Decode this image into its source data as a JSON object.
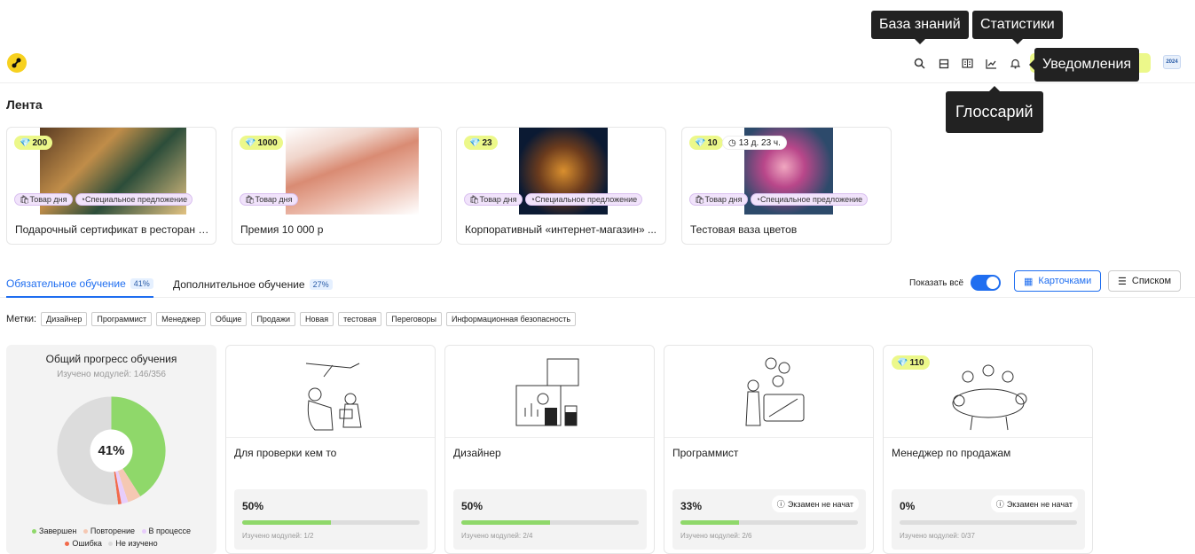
{
  "tooltips": {
    "knowledge": "База знаний",
    "stats": "Статистики",
    "notifications": "Уведомления",
    "glossary": "Глоссарий"
  },
  "header": {
    "avatar_text": "2024"
  },
  "feed": {
    "title": "Лента",
    "products": [
      {
        "cost": "200",
        "tags": [
          "Товар дня",
          "Специальное предложение"
        ],
        "title": "Подарочный сертификат в ресторан н..."
      },
      {
        "cost": "1000",
        "tags": [
          "Товар дня"
        ],
        "title": "Премия 10 000 р"
      },
      {
        "cost": "23",
        "tags": [
          "Товар дня",
          "Специальное предложение"
        ],
        "title": "Корпоративный «интернет-магазин» ..."
      },
      {
        "cost": "10",
        "timer": "13 д. 23 ч.",
        "tags": [
          "Товар дня",
          "Специальное предложение"
        ],
        "title": "Тестовая ваза цветов"
      }
    ]
  },
  "tabs": [
    {
      "label": "Обязательное обучение",
      "pct": "41%"
    },
    {
      "label": "Дополнительное обучение",
      "pct": "27%"
    }
  ],
  "view": {
    "show_all": "Показать всё",
    "cards": "Карточками",
    "list": "Списком"
  },
  "labels": {
    "title": "Метки:",
    "items": [
      "Дизайнер",
      "Программист",
      "Менеджер",
      "Общие",
      "Продажи",
      "Новая",
      "тестовая",
      "Переговоры",
      "Информационная безопасность"
    ]
  },
  "progress": {
    "title": "Общий прогресс обучения",
    "subtitle": "Изучено модулей: 146/356",
    "center": "41%",
    "legend": [
      {
        "label": "Завершен",
        "color": "#8fd86a"
      },
      {
        "label": "Повторение",
        "color": "#f5c8b3"
      },
      {
        "label": "В процессе",
        "color": "#e8cdfb"
      },
      {
        "label": "Ошибка",
        "color": "#f26a4a"
      },
      {
        "label": "Не изучено",
        "color": "#dcdcdc"
      }
    ],
    "segments": [
      0.41,
      0.04,
      0.02,
      0.01,
      0.52
    ]
  },
  "courses": [
    {
      "name": "Для проверки кем то",
      "pct": "50%",
      "progress": 0.5,
      "modules": "Изучено модулей: 1/2"
    },
    {
      "name": "Дизайнер",
      "pct": "50%",
      "progress": 0.5,
      "modules": "Изучено модулей: 2/4"
    },
    {
      "name": "Программист",
      "pct": "33%",
      "progress": 0.33,
      "modules": "Изучено модулей: 2/6",
      "exam": "Экзамен не начат"
    },
    {
      "name": "Менеджер по продажам",
      "pct": "0%",
      "progress": 0,
      "modules": "Изучено модулей: 0/37",
      "exam": "Экзамен не начат",
      "cost": "110"
    }
  ]
}
